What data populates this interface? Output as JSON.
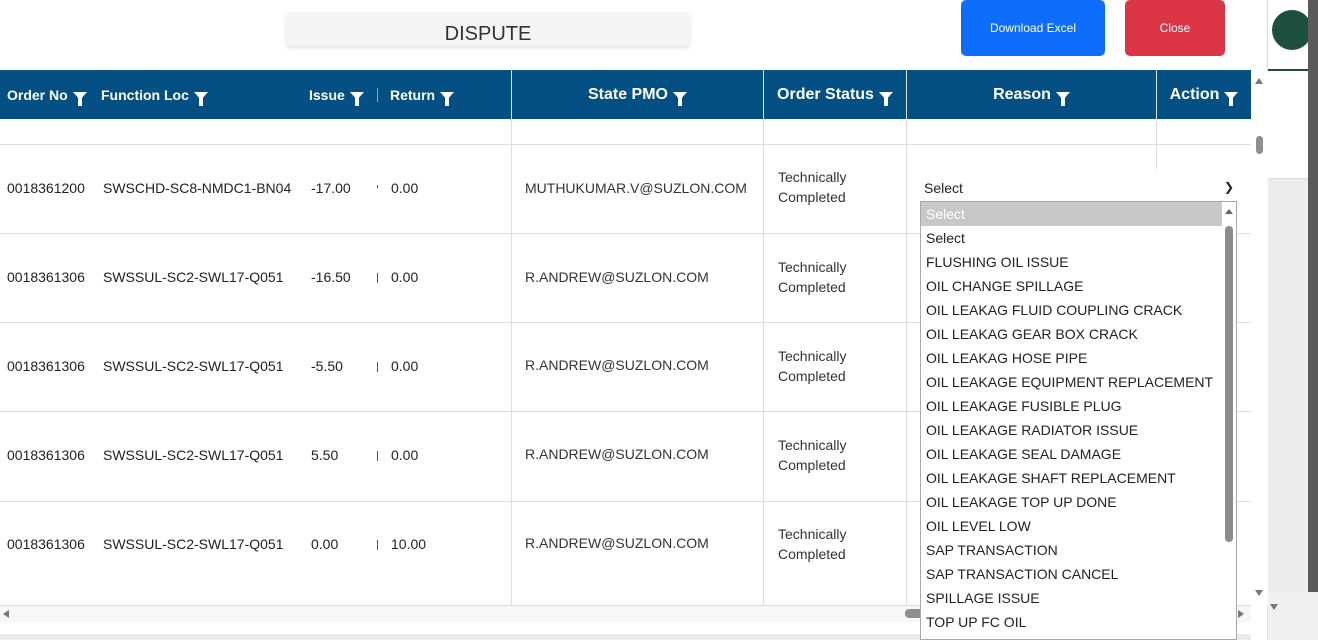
{
  "modal": {
    "title": "DISPUTE",
    "download_label": "Download Excel",
    "close_label": "Close"
  },
  "table": {
    "columns": [
      "Order No",
      "Function Loc",
      "Issue",
      "Return",
      "State PMO",
      "Order Status",
      "Reason",
      "Action"
    ],
    "rows": [
      {
        "order_no": "0018361200",
        "function_loc": "SWSCHD-SC8-NMDC1-BN04",
        "issue": "-17.00",
        "return": "0.00",
        "state_pmo": "MUTHUKUMAR.V@SUZLON.COM",
        "status_line1": "Technically",
        "status_line2": "Completed"
      },
      {
        "order_no": "0018361306",
        "function_loc": "SWSSUL-SC2-SWL17-Q051",
        "issue": "-16.50",
        "return": "0.00",
        "state_pmo": "R.ANDREW@SUZLON.COM",
        "status_line1": "Technically",
        "status_line2": "Completed"
      },
      {
        "order_no": "0018361306",
        "function_loc": "SWSSUL-SC2-SWL17-Q051",
        "issue": "-5.50",
        "return": "0.00",
        "state_pmo": "R.ANDREW@SUZLON.COM",
        "status_line1": "Technically",
        "status_line2": "Completed"
      },
      {
        "order_no": "0018361306",
        "function_loc": "SWSSUL-SC2-SWL17-Q051",
        "issue": "5.50",
        "return": "0.00",
        "state_pmo": "R.ANDREW@SUZLON.COM",
        "status_line1": "Technically",
        "status_line2": "Completed"
      },
      {
        "order_no": "0018361306",
        "function_loc": "SWSSUL-SC2-SWL17-Q051",
        "issue": "0.00",
        "return": "10.00",
        "state_pmo": "R.ANDREW@SUZLON.COM",
        "status_line1": "Technically",
        "status_line2": "Completed"
      }
    ],
    "reason_select_value": "Select"
  },
  "dropdown": {
    "options": [
      "Select",
      "Select",
      "FLUSHING OIL ISSUE",
      "OIL CHANGE SPILLAGE",
      "OIL LEAKAG FLUID COUPLING CRACK",
      "OIL LEAKAG GEAR BOX CRACK",
      "OIL LEAKAG HOSE PIPE",
      "OIL LEAKAGE EQUIPMENT REPLACEMENT",
      "OIL LEAKAGE FUSIBLE PLUG",
      "OIL LEAKAGE RADIATOR ISSUE",
      "OIL LEAKAGE SEAL DAMAGE",
      "OIL LEAKAGE SHAFT REPLACEMENT",
      "OIL LEAKAGE TOP UP DONE",
      "OIL LEVEL LOW",
      "SAP TRANSACTION",
      "SAP TRANSACTION CANCEL",
      "SPILLAGE ISSUE",
      "TOP UP FC OIL"
    ],
    "highlighted_index": 0
  },
  "colors": {
    "header_bg": "#044f83",
    "download_btn": "#0d6efd",
    "close_btn": "#dc3545"
  },
  "icons": {
    "filter": "filter-icon",
    "chevron": "chevron-down-icon"
  }
}
